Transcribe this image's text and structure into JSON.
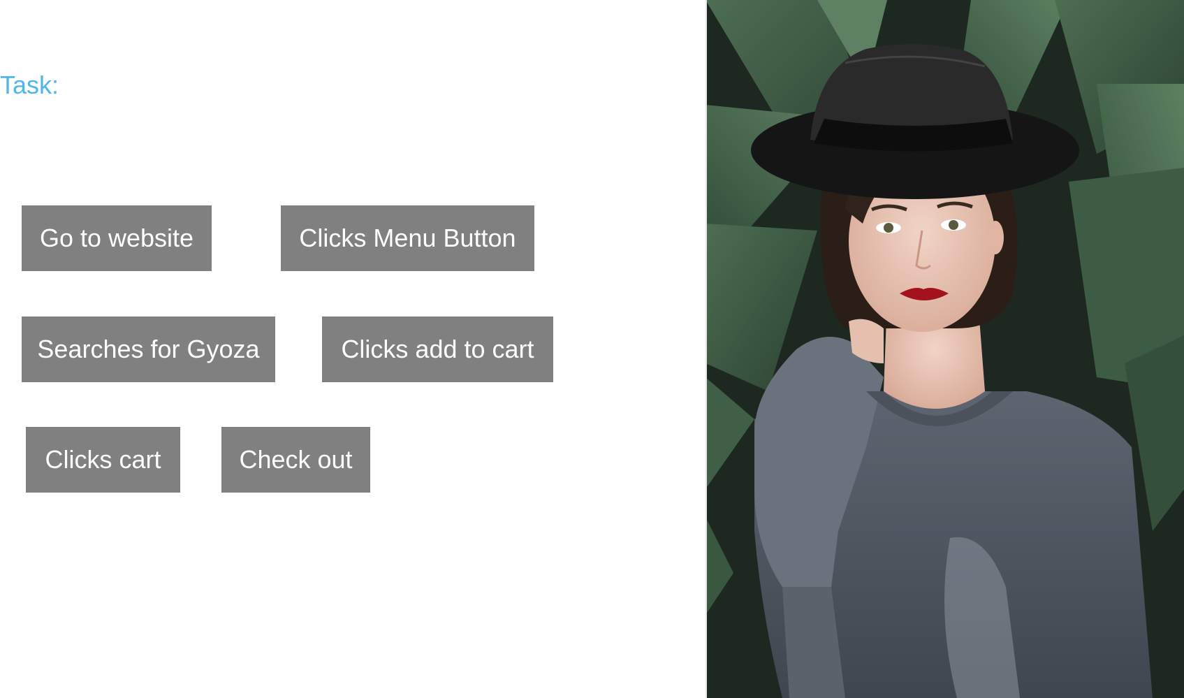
{
  "task": {
    "label": "Task:"
  },
  "steps": [
    {
      "label": "Go to website"
    },
    {
      "label": "Clicks Menu Button"
    },
    {
      "label": "Searches for Gyoza"
    },
    {
      "label": "Clicks add to cart"
    },
    {
      "label": "Clicks cart"
    },
    {
      "label": "Check out"
    }
  ],
  "colors": {
    "task_label": "#4fb6e6",
    "button_bg": "#808080",
    "button_text": "#ffffff"
  }
}
